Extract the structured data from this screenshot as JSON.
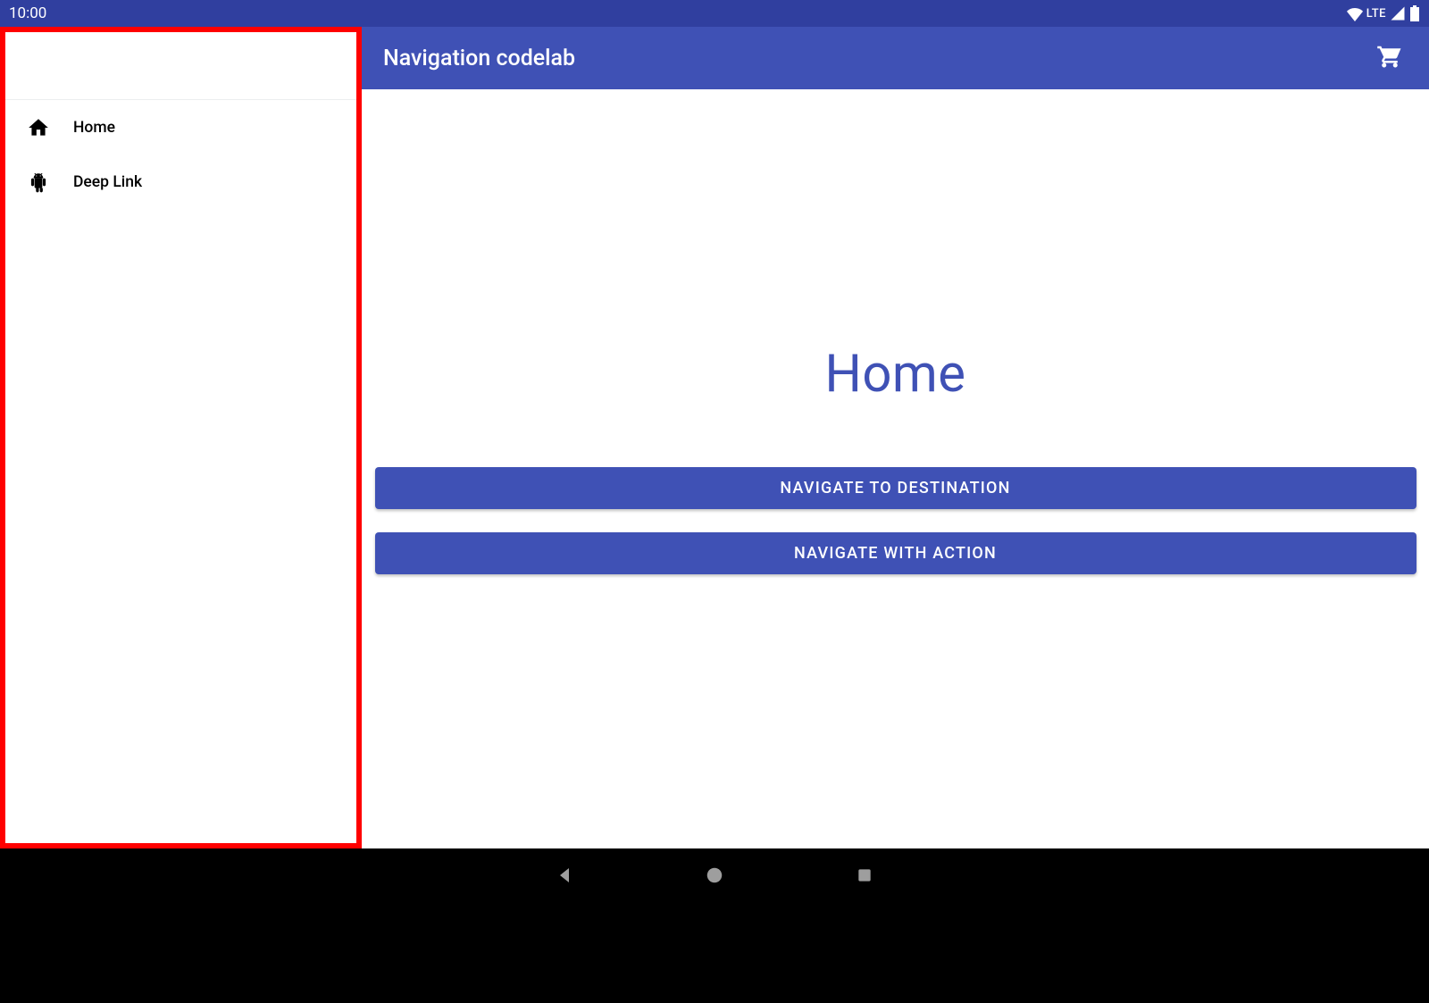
{
  "status_bar": {
    "time": "10:00",
    "network_label": "LTE"
  },
  "drawer": {
    "items": [
      {
        "icon": "home-icon",
        "label": "Home"
      },
      {
        "icon": "android-icon",
        "label": "Deep Link"
      }
    ]
  },
  "app_bar": {
    "title": "Navigation codelab"
  },
  "content": {
    "heading": "Home",
    "buttons": [
      {
        "label": "NAVIGATE TO DESTINATION"
      },
      {
        "label": "NAVIGATE WITH ACTION"
      }
    ]
  },
  "colors": {
    "primary": "#3f51b5",
    "primary_dark": "#303f9f",
    "highlight_rect": "#ff0000"
  }
}
